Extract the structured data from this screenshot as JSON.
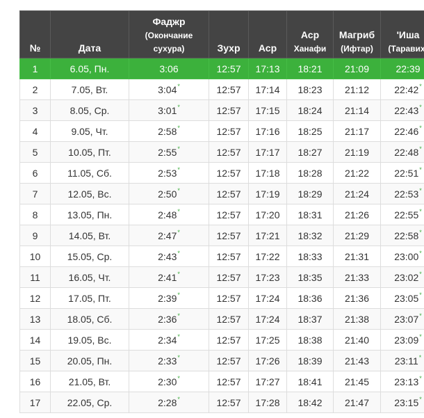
{
  "header": {
    "num": "№",
    "date": "Дата",
    "fajr": "Фаджр",
    "fajr_sub1": "(Окончание",
    "fajr_sub2": "сухура)",
    "zuhr": "Зухр",
    "asr": "Аср",
    "asr_hanafi": "Аср",
    "asr_hanafi_sub": "Ханафи",
    "maghrib": "Магриб",
    "maghrib_sub": "(Ифтар)",
    "isha": "'Иша",
    "isha_sub": "(Таравих)"
  },
  "star_symbol": "*",
  "today_color": "#3cb13c",
  "rows": [
    {
      "num": "1",
      "date": "6.05, Пн.",
      "fajr": "3:06",
      "fajr_star": false,
      "zuhr": "12:57",
      "asr": "17:13",
      "asr_h": "18:21",
      "maghrib": "21:09",
      "isha": "22:39",
      "isha_star": false,
      "today": true
    },
    {
      "num": "2",
      "date": "7.05, Вт.",
      "fajr": "3:04",
      "fajr_star": true,
      "zuhr": "12:57",
      "asr": "17:14",
      "asr_h": "18:23",
      "maghrib": "21:12",
      "isha": "22:42",
      "isha_star": true
    },
    {
      "num": "3",
      "date": "8.05, Ср.",
      "fajr": "3:01",
      "fajr_star": true,
      "zuhr": "12:57",
      "asr": "17:15",
      "asr_h": "18:24",
      "maghrib": "21:14",
      "isha": "22:43",
      "isha_star": true
    },
    {
      "num": "4",
      "date": "9.05, Чт.",
      "fajr": "2:58",
      "fajr_star": true,
      "zuhr": "12:57",
      "asr": "17:16",
      "asr_h": "18:25",
      "maghrib": "21:17",
      "isha": "22:46",
      "isha_star": true
    },
    {
      "num": "5",
      "date": "10.05, Пт.",
      "fajr": "2:55",
      "fajr_star": true,
      "zuhr": "12:57",
      "asr": "17:17",
      "asr_h": "18:27",
      "maghrib": "21:19",
      "isha": "22:48",
      "isha_star": true
    },
    {
      "num": "6",
      "date": "11.05, Сб.",
      "fajr": "2:53",
      "fajr_star": true,
      "zuhr": "12:57",
      "asr": "17:18",
      "asr_h": "18:28",
      "maghrib": "21:22",
      "isha": "22:51",
      "isha_star": true
    },
    {
      "num": "7",
      "date": "12.05, Вс.",
      "fajr": "2:50",
      "fajr_star": true,
      "zuhr": "12:57",
      "asr": "17:19",
      "asr_h": "18:29",
      "maghrib": "21:24",
      "isha": "22:53",
      "isha_star": true
    },
    {
      "num": "8",
      "date": "13.05, Пн.",
      "fajr": "2:48",
      "fajr_star": true,
      "zuhr": "12:57",
      "asr": "17:20",
      "asr_h": "18:31",
      "maghrib": "21:26",
      "isha": "22:55",
      "isha_star": true
    },
    {
      "num": "9",
      "date": "14.05, Вт.",
      "fajr": "2:47",
      "fajr_star": true,
      "zuhr": "12:57",
      "asr": "17:21",
      "asr_h": "18:32",
      "maghrib": "21:29",
      "isha": "22:58",
      "isha_star": true
    },
    {
      "num": "10",
      "date": "15.05, Ср.",
      "fajr": "2:43",
      "fajr_star": true,
      "zuhr": "12:57",
      "asr": "17:22",
      "asr_h": "18:33",
      "maghrib": "21:31",
      "isha": "23:00",
      "isha_star": true
    },
    {
      "num": "11",
      "date": "16.05, Чт.",
      "fajr": "2:41",
      "fajr_star": true,
      "zuhr": "12:57",
      "asr": "17:23",
      "asr_h": "18:35",
      "maghrib": "21:33",
      "isha": "23:02",
      "isha_star": true
    },
    {
      "num": "12",
      "date": "17.05, Пт.",
      "fajr": "2:39",
      "fajr_star": true,
      "zuhr": "12:57",
      "asr": "17:24",
      "asr_h": "18:36",
      "maghrib": "21:36",
      "isha": "23:05",
      "isha_star": true
    },
    {
      "num": "13",
      "date": "18.05, Сб.",
      "fajr": "2:36",
      "fajr_star": true,
      "zuhr": "12:57",
      "asr": "17:24",
      "asr_h": "18:37",
      "maghrib": "21:38",
      "isha": "23:07",
      "isha_star": true
    },
    {
      "num": "14",
      "date": "19.05, Вс.",
      "fajr": "2:34",
      "fajr_star": true,
      "zuhr": "12:57",
      "asr": "17:25",
      "asr_h": "18:38",
      "maghrib": "21:40",
      "isha": "23:09",
      "isha_star": true
    },
    {
      "num": "15",
      "date": "20.05, Пн.",
      "fajr": "2:33",
      "fajr_star": true,
      "zuhr": "12:57",
      "asr": "17:26",
      "asr_h": "18:39",
      "maghrib": "21:43",
      "isha": "23:11",
      "isha_star": true
    },
    {
      "num": "16",
      "date": "21.05, Вт.",
      "fajr": "2:30",
      "fajr_star": true,
      "zuhr": "12:57",
      "asr": "17:27",
      "asr_h": "18:41",
      "maghrib": "21:45",
      "isha": "23:13",
      "isha_star": true
    },
    {
      "num": "17",
      "date": "22.05, Ср.",
      "fajr": "2:28",
      "fajr_star": true,
      "zuhr": "12:57",
      "asr": "17:28",
      "asr_h": "18:42",
      "maghrib": "21:47",
      "isha": "23:15",
      "isha_star": true
    }
  ]
}
